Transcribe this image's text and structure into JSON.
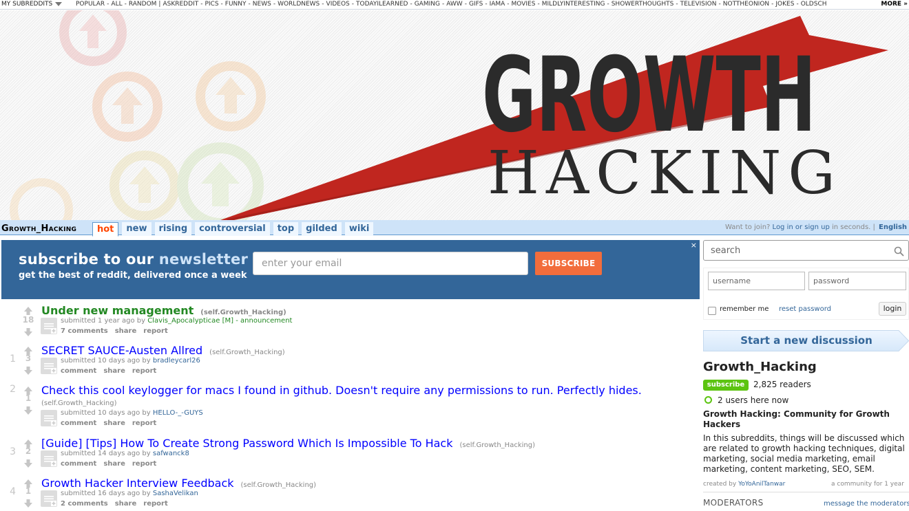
{
  "topbar": {
    "my_subreddits": "MY SUBREDDITS",
    "links": [
      "POPULAR",
      "ALL",
      "RANDOM",
      "|",
      "ASKREDDIT",
      "PICS",
      "FUNNY",
      "NEWS",
      "WORLDNEWS",
      "VIDEOS",
      "TODAYILEARNED",
      "GAMING",
      "AWW",
      "GIFS",
      "IAMA",
      "MOVIES",
      "MILDLYINTERESTING",
      "SHOWERTHOUGHTS",
      "TELEVISION",
      "NOTTHEONION",
      "JOKES",
      "OLDSCH"
    ],
    "more": "MORE »"
  },
  "banner": {
    "line1": "GROWTH",
    "line2": "HACKING",
    "colors": {
      "arrow": "#c0261f",
      "text": "#2b2b2b"
    }
  },
  "tabbar": {
    "subreddit_name": "Growth_Hacking",
    "tabs": [
      "hot",
      "new",
      "rising",
      "controversial",
      "top",
      "gilded",
      "wiki"
    ],
    "selected_tab": "hot",
    "join_prefix": "Want to join?",
    "join_link": "Log in or sign up",
    "join_suffix": "in seconds.",
    "language": "English"
  },
  "newsletter": {
    "heading_prefix": "subscribe to our",
    "heading_highlight": "newsletter",
    "subheading": "get the best of reddit, delivered once a week",
    "email_placeholder": "enter your email",
    "subscribe_label": "SUBSCRIBE",
    "close": "×"
  },
  "posts": [
    {
      "rank": "",
      "score": "18",
      "title": "Under new management",
      "domain": "(self.Growth_Hacking)",
      "submitted": "submitted 1 year ago by",
      "author": "Clavis_Apocalypticae",
      "mod_tag": "[M]",
      "flair": "- announcement",
      "comments": "7 comments",
      "share": "share",
      "report": "report"
    },
    {
      "rank": "1",
      "score": "3",
      "title": "SECRET SAUCE-Austen Allred",
      "domain": "(self.Growth_Hacking)",
      "submitted": "submitted 10 days ago by",
      "author": "bradleycarl26",
      "comments": "comment",
      "share": "share",
      "report": "report"
    },
    {
      "rank": "2",
      "score": "1",
      "title": "Check this cool keylogger for macs I found in github. Doesn't require any permissions to run. Perfectly hides.",
      "domain": "(self.Growth_Hacking)",
      "submitted": "submitted 10 days ago by",
      "author": "HELLO-_-GUYS",
      "comments": "comment",
      "share": "share",
      "report": "report"
    },
    {
      "rank": "3",
      "score": "2",
      "title": "[Guide] [Tips] How To Create Strong Password Which Is Impossible To Hack",
      "domain": "(self.Growth_Hacking)",
      "submitted": "submitted 14 days ago by",
      "author": "safwanck8",
      "comments": "comment",
      "share": "share",
      "report": "report"
    },
    {
      "rank": "4",
      "score": "1",
      "title": "Growth Hacker Interview Feedback",
      "domain": "(self.Growth_Hacking)",
      "submitted": "submitted 16 days ago by",
      "author": "SashaVelikan",
      "comments": "2 comments",
      "share": "share",
      "report": "report"
    }
  ],
  "sidebar": {
    "search_placeholder": "search",
    "username_placeholder": "username",
    "password_placeholder": "password",
    "remember_me": "remember me",
    "reset_password": "reset password",
    "login": "login",
    "start_discussion": "Start a new discussion",
    "subreddit_title": "Growth_Hacking",
    "subscribe": "subscribe",
    "readers": "2,825 readers",
    "online": "2 users here now",
    "description_heading": "Growth Hacking: Community for Growth Hackers",
    "description": "In this subreddits, things will be discussed which are related to growth hacking techniques, digital marketing, social media marketing, email marketing, content marketing, SEO, SEM.",
    "created_by_prefix": "created by",
    "created_by": "YoYoAnilTanwar",
    "community_age": "a community for 1 year",
    "moderators_heading": "MODERATORS",
    "message_moderators": "message the moderators"
  }
}
